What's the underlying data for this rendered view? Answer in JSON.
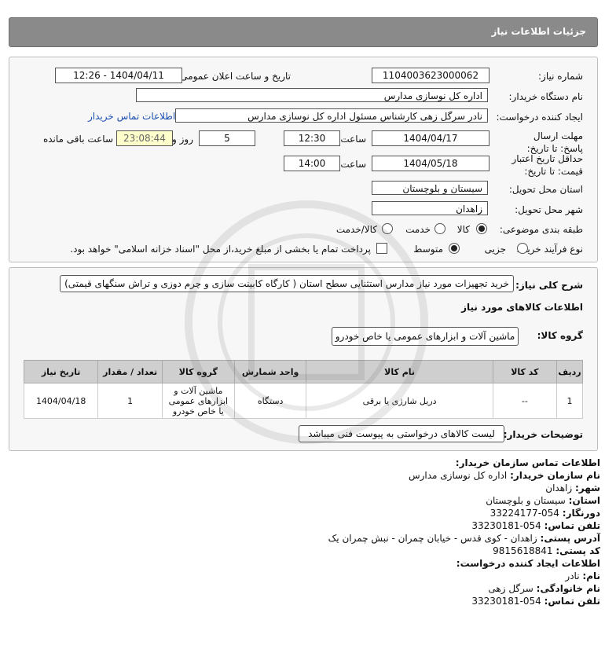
{
  "page_title": "جزئیات اطلاعات نیاز",
  "fields": {
    "need_number_label": "شماره نیاز:",
    "need_number": "1104003623000062",
    "announce_label": "تاریخ و ساعت اعلان عمومی:",
    "announce_value": "1404/04/11 - 12:26",
    "buyer_label": "نام دستگاه خریدار:",
    "buyer_value": "اداره کل نوسازی مدارس",
    "creator_label": "ایجاد کننده درخواست:",
    "creator_value": "نادر سرگل زهی کارشناس مسئول اداره کل نوسازی مدارس",
    "contact_link": "اطلاعات تماس خریدار",
    "deadline_label": "مهلت ارسال پاسخ: تا تاریخ:",
    "deadline_date": "1404/04/17",
    "time_label": "ساعت",
    "deadline_time": "12:30",
    "days_value": "5",
    "days_label": "روز و",
    "remaining_time": "23:08:44",
    "remaining_label": "ساعت باقی مانده",
    "validity_label": "حداقل تاریخ اعتبار قیمت: تا تاریخ:",
    "validity_date": "1404/05/18",
    "validity_time": "14:00",
    "province_label": "استان محل تحویل:",
    "province_value": "سیستان و بلوچستان",
    "city_label": "شهر محل تحویل:",
    "city_value": "زاهدان",
    "category_label": "طبقه بندی موضوعی:",
    "category_options": [
      "کالا",
      "خدمت",
      "کالا/خدمت"
    ],
    "process_label": "نوع فرآیند خرید :",
    "process_options": [
      "جزیی",
      "متوسط"
    ],
    "payment_note": "پرداخت تمام یا بخشی از مبلغ خرید،از محل \"اسناد خزانه اسلامی\" خواهد بود."
  },
  "description": {
    "label": "شرح کلی نیاز:",
    "value": "خرید تجهیزات مورد نیاز مدارس استثنایی سطح استان ( کارگاه کابینت سازی و چرم دوزی و تراش سنگهای قیمتی)"
  },
  "goods": {
    "section_title": "اطلاعات کالاهای مورد نیاز",
    "group_label": "گروه کالا:",
    "group_value": "ماشین آلات و ابزارهای عمومی یا خاص خودرو",
    "columns": [
      "ردیف",
      "کد کالا",
      "نام کالا",
      "واحد شمارش",
      "گروه کالا",
      "تعداد / مقدار",
      "تاریخ نیاز"
    ],
    "rows": [
      [
        "1",
        "--",
        "دریل شارژی یا برقی",
        "دستگاه",
        "ماشین آلات و ابزارهای عمومی یا خاص خودرو",
        "1",
        "1404/04/18"
      ]
    ]
  },
  "buyer_notes": {
    "label": "توضیحات خریدار:",
    "value": "لیست کالاهای درخواستی به پیوست فنی میباشد"
  },
  "contact": {
    "heading": "اطلاعات تماس سازمان خریدار:",
    "org_label": "نام سازمان خریدار:",
    "org_value": "اداره کل نوسازی مدارس",
    "city_label": "شهر:",
    "city_value": "زاهدان",
    "province_label": "استان:",
    "province_value": "سیستان و بلوچستان",
    "fax_label": "دورنگار:",
    "fax_value": "054-33224177",
    "phone_label": "تلفن تماس:",
    "phone_value": "054-33230181",
    "address_label": "آدرس پستی:",
    "address_value": "زاهدان - کوی قدس - خیابان چمران - نبش چمران یک",
    "postal_label": "کد پستی:",
    "postal_value": "9815618841",
    "creator_heading": "اطلاعات ایجاد کننده درخواست:",
    "name_label": "نام:",
    "name_value": "نادر",
    "family_label": "نام خانوادگی:",
    "family_value": "سرگل زهی",
    "creator_phone_label": "تلفن تماس:",
    "creator_phone_value": "054-33230181"
  },
  "colors": {
    "title_bg": "#8a8a8a",
    "link": "#1a4fb0",
    "header_cell": "#cfcfcf"
  }
}
